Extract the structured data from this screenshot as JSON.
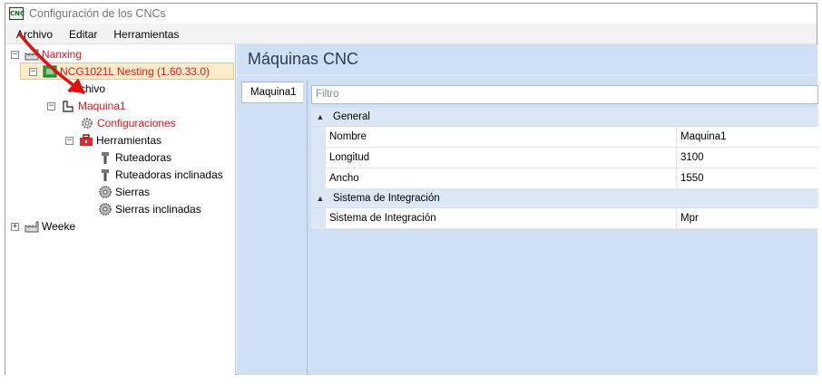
{
  "window": {
    "title": "Configuración de los CNCs",
    "app_icon_text": "CNC"
  },
  "menu": [
    "Archivo",
    "Editar",
    "Herramientas"
  ],
  "tree": {
    "root1": "Nanxing",
    "machine_model": "NCG1021L Nesting (1.60.33.0)",
    "archivo": "Archivo",
    "maquina": "Maquina1",
    "configuraciones": "Configuraciones",
    "herramientas": "Herramientas",
    "tools": [
      "Ruteadoras",
      "Ruteadoras inclinadas",
      "Sierras",
      "Sierras inclinadas"
    ],
    "root2": "Weeke"
  },
  "main": {
    "header": "Máquinas CNC",
    "tab": "Maquina1",
    "filter_placeholder": "Filtro",
    "categories": [
      {
        "name": "General",
        "props": [
          {
            "name": "Nombre",
            "value": "Maquina1"
          },
          {
            "name": "Longitud",
            "value": "3100"
          },
          {
            "name": "Ancho",
            "value": "1550"
          }
        ]
      },
      {
        "name": "Sistema de Integración",
        "props": [
          {
            "name": "Sistema de Integración",
            "value": "Mpr"
          }
        ]
      }
    ]
  },
  "colors": {
    "selected_bg": "#fdecc8",
    "highlight_text": "#e8141b",
    "pane_blue": "#cfe0f5"
  }
}
